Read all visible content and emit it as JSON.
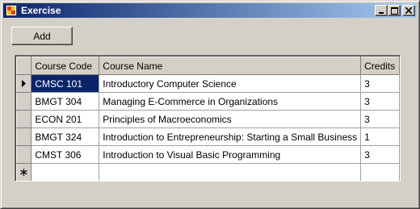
{
  "window": {
    "title": "Exercise"
  },
  "toolbar": {
    "add_label": "Add"
  },
  "grid": {
    "columns": [
      "Course Code",
      "Course Name",
      "Credits"
    ],
    "rows": [
      {
        "code": "CMSC 101",
        "name": "Introductory Computer Science",
        "credits": "3"
      },
      {
        "code": "BMGT 304",
        "name": "Managing E-Commerce in Organizations",
        "credits": "3"
      },
      {
        "code": "ECON 201",
        "name": "Principles of Macroeconomics",
        "credits": "3"
      },
      {
        "code": "BMGT 324",
        "name": "Introduction to Entrepreneurship: Starting a Small Business",
        "credits": "1"
      },
      {
        "code": "CMST 306",
        "name": "Introduction to Visual Basic Programming",
        "credits": "3"
      }
    ],
    "current_row_indicator": "current-row-arrow-icon",
    "new_row_indicator": "new-row-asterisk-icon"
  },
  "colors": {
    "title_start": "#0a246a",
    "title_end": "#a6caf0",
    "selection": "#0a246a",
    "face": "#d4d0c8"
  }
}
